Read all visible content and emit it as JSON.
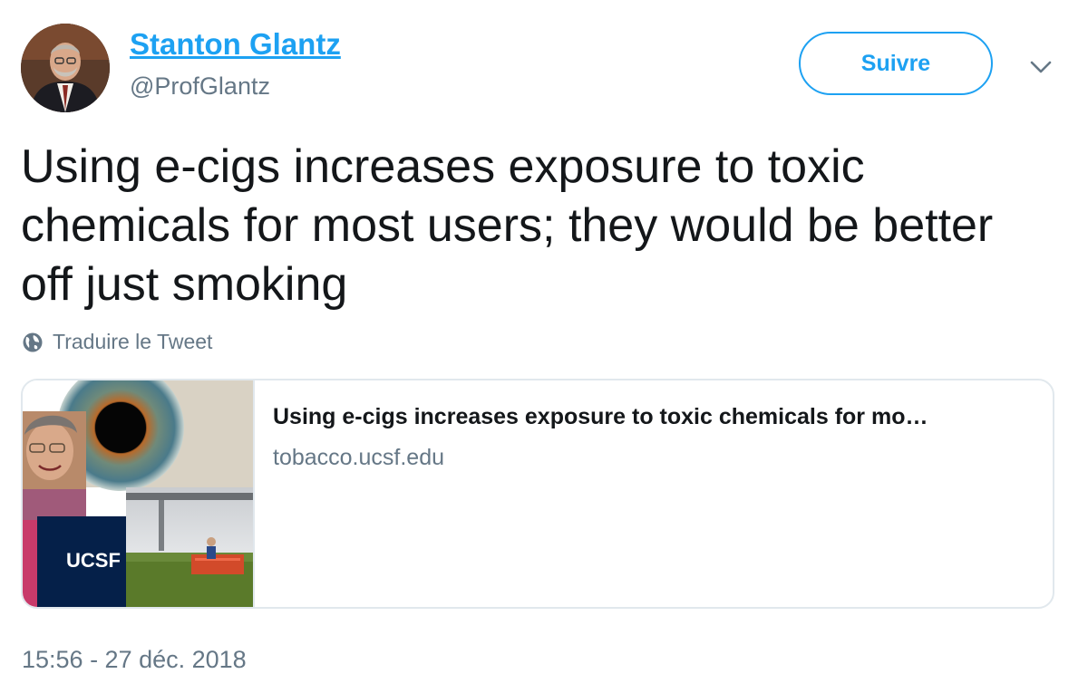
{
  "author": {
    "display_name": "Stanton Glantz",
    "handle": "@ProfGlantz"
  },
  "follow_button": {
    "label": "Suivre"
  },
  "tweet": {
    "text": "Using e-cigs increases exposure to toxic chemicals for most users; they would be better off just smoking",
    "translate_label": "Traduire le Tweet",
    "timestamp": "15:56 - 27 déc. 2018"
  },
  "link_card": {
    "title": "Using e-cigs increases exposure to toxic chemicals for mo…",
    "domain": "tobacco.ucsf.edu",
    "logo_text": "UCSF"
  },
  "icons": {
    "more": "chevron-down-icon",
    "translate": "globe-icon"
  },
  "colors": {
    "accent": "#1da1f2",
    "text": "#14171a",
    "muted": "#657786",
    "card_border": "#e1e8ed",
    "ucsf_navy": "#052049"
  }
}
